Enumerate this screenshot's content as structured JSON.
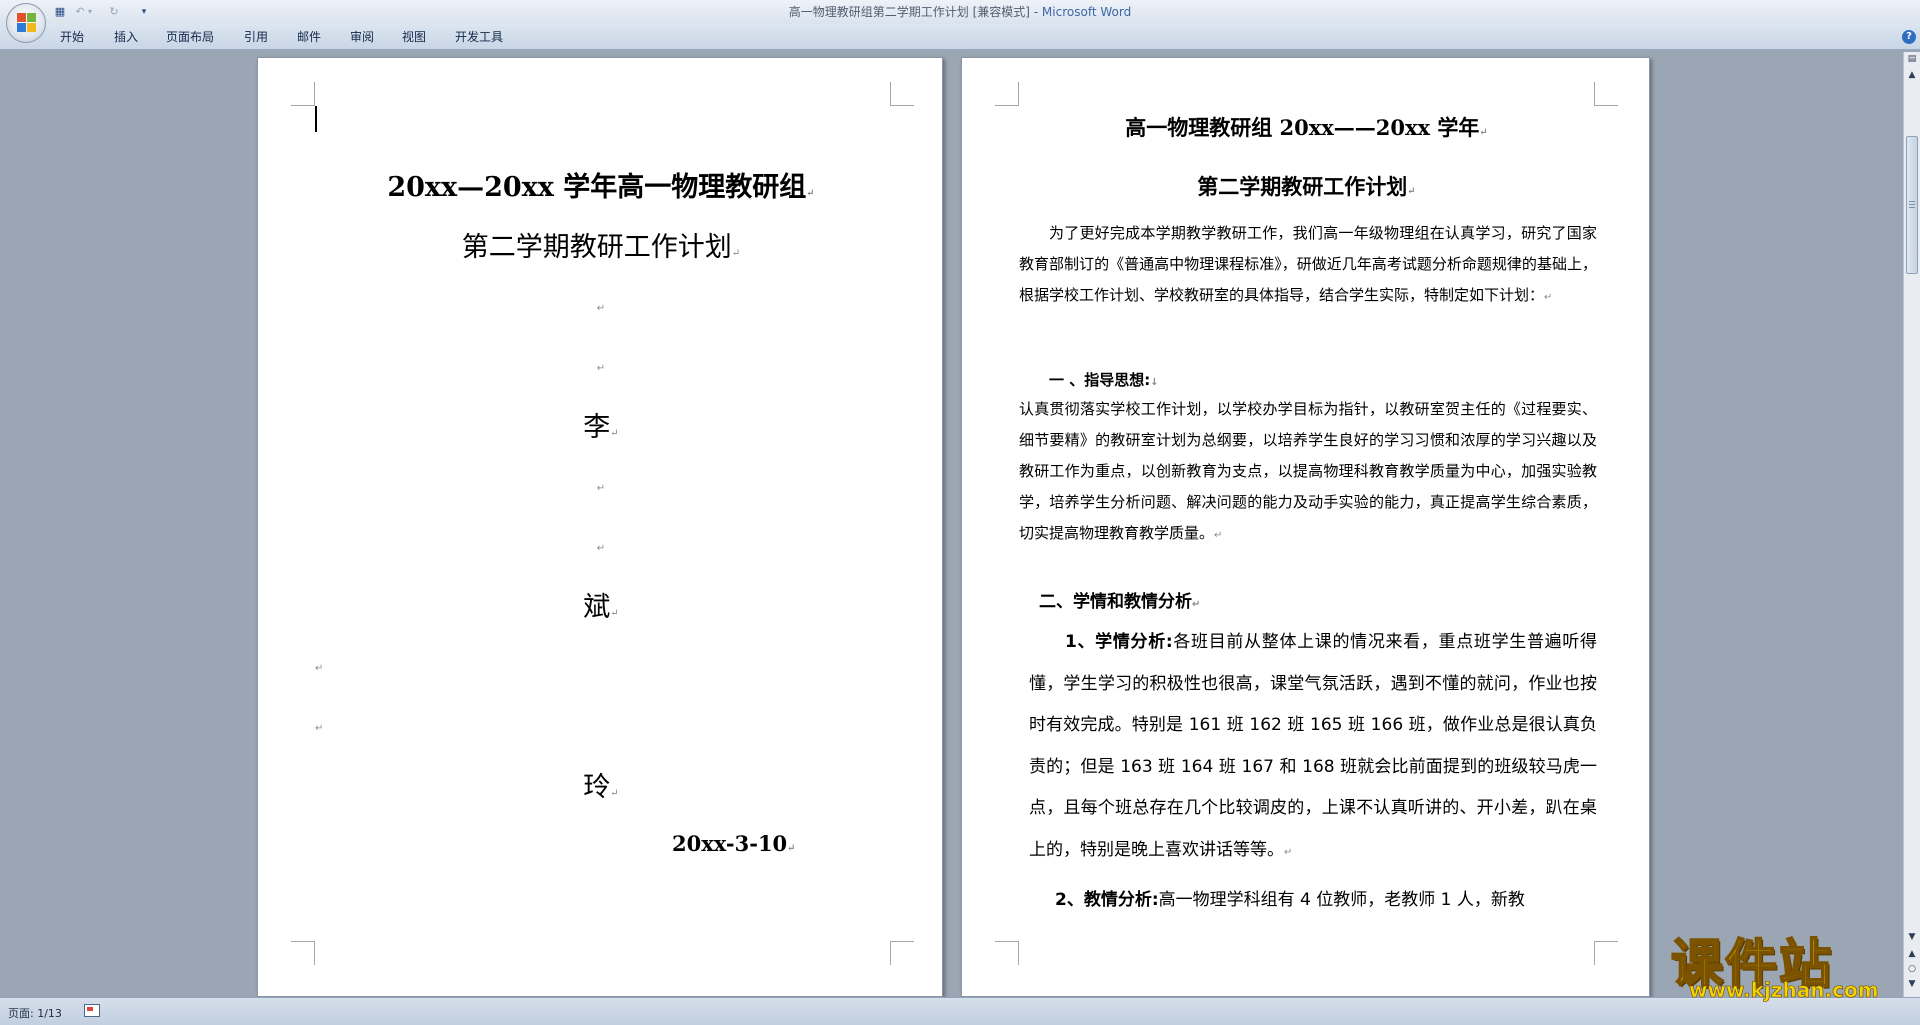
{
  "window": {
    "title": "高一物理教研组第二学期工作计划 [兼容模式] - ",
    "app_name": "Microsoft Word"
  },
  "quick_access": {
    "icons": [
      "save-icon",
      "undo-icon",
      "redo-icon",
      "customize-icon"
    ]
  },
  "ribbon": {
    "tabs": [
      "开始",
      "插入",
      "页面布局",
      "引用",
      "邮件",
      "审阅",
      "视图",
      "开发工具"
    ]
  },
  "status": {
    "page_info": "页面: 1/13"
  },
  "page1": {
    "title": "20xx—20xx 学年高一物理教研组",
    "subtitle": "第二学期教研工作计划",
    "name_chars": [
      "李",
      "斌",
      "玲"
    ],
    "date": "20xx-3-10",
    "para_mark": "↵"
  },
  "page2": {
    "heading1": "高一物理教研组 20xx——20xx 学年",
    "heading2": "第二学期教研工作计划",
    "intro": "为了更好完成本学期教学教研工作，我们高一年级物理组在认真学习，研究了国家教育部制订的《普通高中物理课程标准》，研做近几年高考试题分析命题规律的基础上，根据学校工作计划、学校教研室的具体指导，结合学生实际，特制定如下计划：",
    "section1_title": "一 、指导思想:",
    "section1_body": "认真贯彻落实学校工作计划，以学校办学目标为指针，以教研室贺主任的《过程要实、细节要精》的教研室计划为总纲要，以培养学生良好的学习习惯和浓厚的学习兴趣以及教研工作为重点，以创新教育为支点，以提高物理科教育教学质量为中心，加强实验教学，培养学生分析问题、解决问题的能力及动手实验的能力，真正提高学生综合素质，切实提高物理教育教学质量。",
    "section2_title": "二、学情和教情分析",
    "item1_label": "1、学情分析:",
    "item1_body": "各班目前从整体上课的情况来看，重点班学生普遍听得懂，学生学习的积极性也很高，课堂气氛活跃，遇到不懂的就问，作业也按时有效完成。特别是 161 班 162 班 165 班 166 班，做作业总是很认真负责的；但是 163 班 164 班 167 和 168 班就会比前面提到的班级较马虎一点，且每个班总存在几个比较调皮的，上课不认真听讲的、开小差，趴在桌上的，特别是晚上喜欢讲话等等。",
    "item2_label": "2、教情分析:",
    "item2_body": "高一物理学科组有 4 位教师，老教师 1 人，新教"
  },
  "watermark": {
    "text": "课件站",
    "url": "www.kjzhan.com",
    "color": "#f6d400"
  },
  "colors": {
    "workspace": "#9ba6b5",
    "title_app": "#3f66a8"
  }
}
